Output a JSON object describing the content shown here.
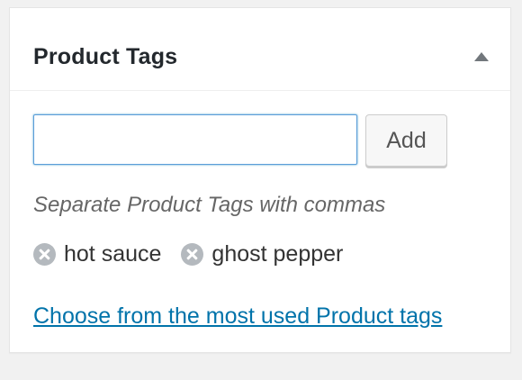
{
  "panel": {
    "title": "Product Tags",
    "toggle_icon": "triangle-up-icon"
  },
  "tag_input": {
    "value": "",
    "placeholder": ""
  },
  "add_button": {
    "label": "Add"
  },
  "hint": "Separate Product Tags with commas",
  "tags": [
    {
      "label": "hot sauce",
      "remove_icon": "remove-circle-icon"
    },
    {
      "label": "ghost pepper",
      "remove_icon": "remove-circle-icon"
    }
  ],
  "most_used_link": "Choose from the most used Product tags",
  "colors": {
    "link": "#0073aa",
    "input_focus_border": "#5b9dd9",
    "remove_icon": "#b4b9be",
    "background": "#f1f1f1"
  }
}
